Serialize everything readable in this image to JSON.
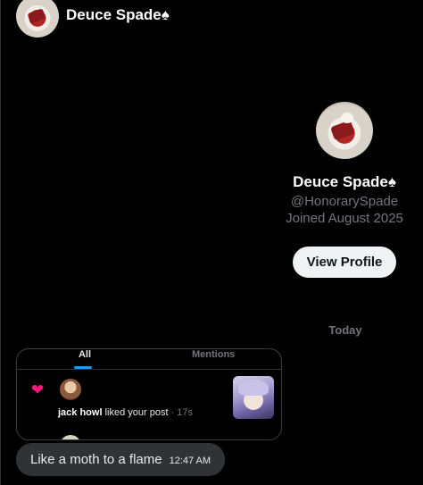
{
  "header": {
    "name": "Deuce Spade♠",
    "avatar_icon": "user-avatar"
  },
  "profile": {
    "name": "Deuce Spade♠",
    "handle": "@HonorarySpade",
    "joined": "Joined August 2025",
    "view_profile_label": "View Profile"
  },
  "divider_label": "Today",
  "shared_image": {
    "tabs": [
      "All",
      "Mentions"
    ],
    "active_tab": "All",
    "notification": {
      "icon": "heart-icon",
      "user": "jack howl",
      "action": " liked your post",
      "time": " · 17s"
    }
  },
  "message": {
    "text": "Like a moth to a flame",
    "time": "12:47 AM"
  },
  "colors": {
    "background": "#000000",
    "accent_blue": "#1d9bf0",
    "like_pink": "#f91880",
    "bubble": "#2f3336",
    "muted_text": "#71767b"
  }
}
